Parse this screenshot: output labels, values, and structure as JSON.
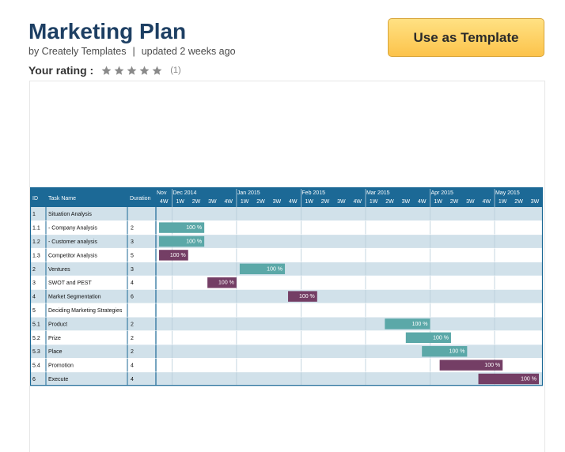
{
  "header": {
    "title": "Marketing Plan",
    "author": "by Creately Templates",
    "separator": "|",
    "updated": "updated 2 weeks ago",
    "rating_label": "Your rating :",
    "rating_stars": 5,
    "rating_count": "(1)",
    "cta_label": "Use as Template"
  },
  "colors": {
    "header_bg": "#1c6996",
    "row_alt": "#d1e1ea",
    "bar_teal": "#5ba8a8",
    "bar_purple": "#743e65",
    "cta": "#fcc34b"
  },
  "gantt": {
    "columns": {
      "id": "ID",
      "task": "Task Name",
      "duration": "Duration"
    },
    "months": [
      "Nov",
      "Dec 2014",
      "Jan 2015",
      "Feb 2015",
      "Mar 2015",
      "Apr 2015",
      "May 2015"
    ],
    "weeks": [
      "4W",
      "1W",
      "2W",
      "3W",
      "4W",
      "1W",
      "2W",
      "3W",
      "4W",
      "1W",
      "2W",
      "3W",
      "4W",
      "1W",
      "2W",
      "3W",
      "4W",
      "1W",
      "2W",
      "3W",
      "4W",
      "1W",
      "2W",
      "3W"
    ],
    "tasks": [
      {
        "id": "1",
        "name": "Situation Analysis",
        "duration": "",
        "bar": null
      },
      {
        "id": "1.1",
        "name": "- Company Analysis",
        "duration": "2",
        "bar": {
          "start": 0,
          "end": 3,
          "color": "teal",
          "label": "100 %"
        }
      },
      {
        "id": "1.2",
        "name": "- Customer analysis",
        "duration": "3",
        "bar": {
          "start": 0,
          "end": 3,
          "color": "teal",
          "label": "100 %"
        }
      },
      {
        "id": "1.3",
        "name": "Competitor Analysis",
        "duration": "5",
        "bar": {
          "start": 0,
          "end": 2,
          "color": "purple",
          "label": "100 %"
        }
      },
      {
        "id": "2",
        "name": "Ventures",
        "duration": "3",
        "bar": {
          "start": 5,
          "end": 8,
          "color": "teal",
          "label": "100 %"
        }
      },
      {
        "id": "3",
        "name": "SWOT and PEST",
        "duration": "4",
        "bar": {
          "start": 3,
          "end": 5,
          "color": "purple",
          "label": "100 %"
        }
      },
      {
        "id": "4",
        "name": "Market Segmentation",
        "duration": "6",
        "bar": {
          "start": 8,
          "end": 10,
          "color": "purple",
          "label": "100 %"
        }
      },
      {
        "id": "5",
        "name": "Deciding Marketing Strategies",
        "duration": "",
        "bar": null
      },
      {
        "id": "5.1",
        "name": "Product",
        "duration": "2",
        "bar": {
          "start": 14,
          "end": 17,
          "color": "teal",
          "label": "100 %"
        }
      },
      {
        "id": "5.2",
        "name": "Prize",
        "duration": "2",
        "bar": {
          "start": 15.3,
          "end": 18.3,
          "color": "teal",
          "label": "100 %"
        }
      },
      {
        "id": "5.3",
        "name": "Place",
        "duration": "2",
        "bar": {
          "start": 16.3,
          "end": 19.3,
          "color": "teal",
          "label": "100 %"
        }
      },
      {
        "id": "5.4",
        "name": "Promotion",
        "duration": "4",
        "bar": {
          "start": 17.4,
          "end": 21.5,
          "color": "purple",
          "label": "100 %"
        }
      },
      {
        "id": "6",
        "name": "Execute",
        "duration": "4",
        "bar": {
          "start": 19.8,
          "end": 24,
          "color": "purple",
          "label": "100 %"
        }
      }
    ]
  }
}
